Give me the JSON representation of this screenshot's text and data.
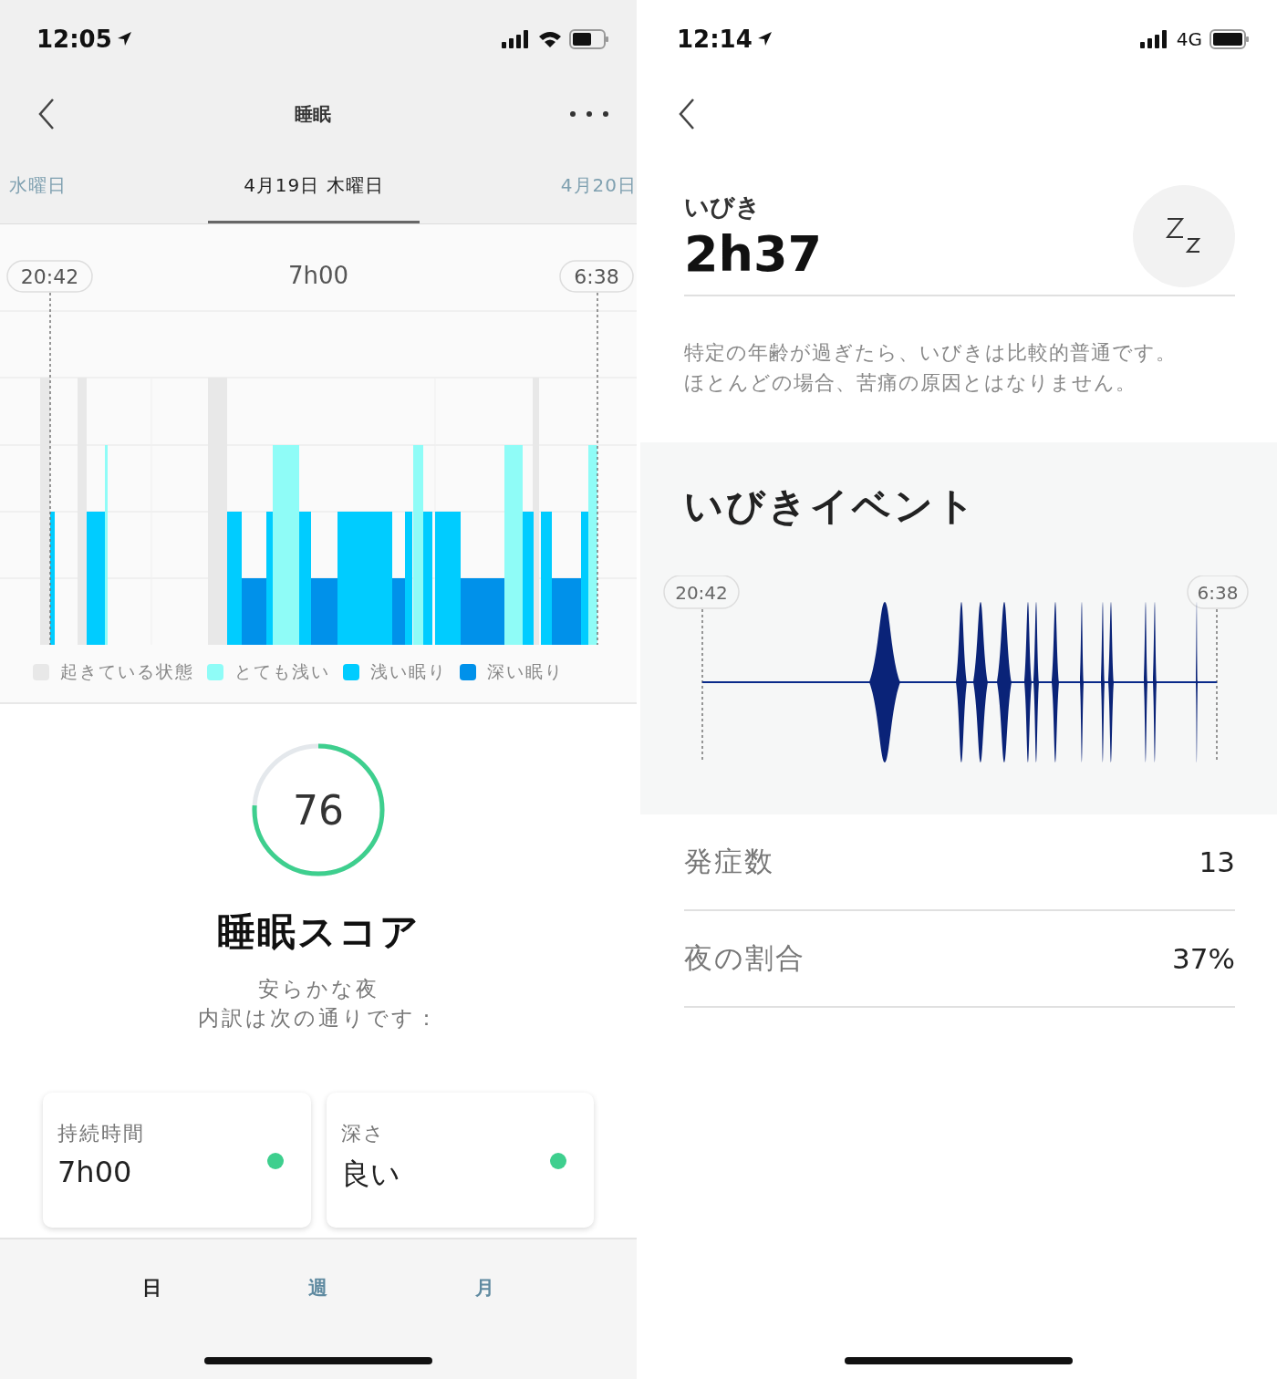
{
  "left_screen": {
    "status_bar": {
      "time": "12:05"
    },
    "nav": {
      "title": "睡眠"
    },
    "date_tabs": [
      {
        "label": "水曜日",
        "selected": false
      },
      {
        "label": "4月19日 木曜日",
        "selected": true
      },
      {
        "label": "4月20日",
        "selected": false
      }
    ],
    "sleep_chart": {
      "start": "20:42",
      "duration": "7h00",
      "end": "6:38",
      "legend": [
        {
          "label": "起きている状態",
          "color": "#e8e8e8"
        },
        {
          "label": "とても浅い",
          "color": "#8ffcf7"
        },
        {
          "label": "浅い眠り",
          "color": "#00ccff"
        },
        {
          "label": "深い眠り",
          "color": "#0091ea"
        }
      ]
    },
    "score": {
      "value": "76",
      "title": "睡眠スコア",
      "lines": [
        "安らかな夜",
        "内訳は次の通りです："
      ]
    },
    "cards": [
      {
        "label": "持続時間",
        "value": "7h00",
        "color": "#3ecf8e"
      },
      {
        "label": "深さ",
        "value": "良い",
        "color": "#3ecf8e"
      }
    ],
    "period_tabs": [
      {
        "label": "日",
        "selected": true
      },
      {
        "label": "週",
        "selected": false
      },
      {
        "label": "月",
        "selected": false
      }
    ]
  },
  "right_screen": {
    "status_bar": {
      "time": "12:14",
      "network": "4G"
    },
    "title": "いびき",
    "duration": "2h37",
    "description": [
      "特定の年齢が過ぎたら、いびきは比較的普通です。",
      "ほとんどの場合、苦痛の原因とはなりません。"
    ],
    "events": {
      "title": "いびきイベント",
      "start": "20:42",
      "end": "6:38"
    },
    "stats": [
      {
        "label": "発症数",
        "value": "13"
      },
      {
        "label": "夜の割合",
        "value": "37%"
      }
    ]
  }
}
